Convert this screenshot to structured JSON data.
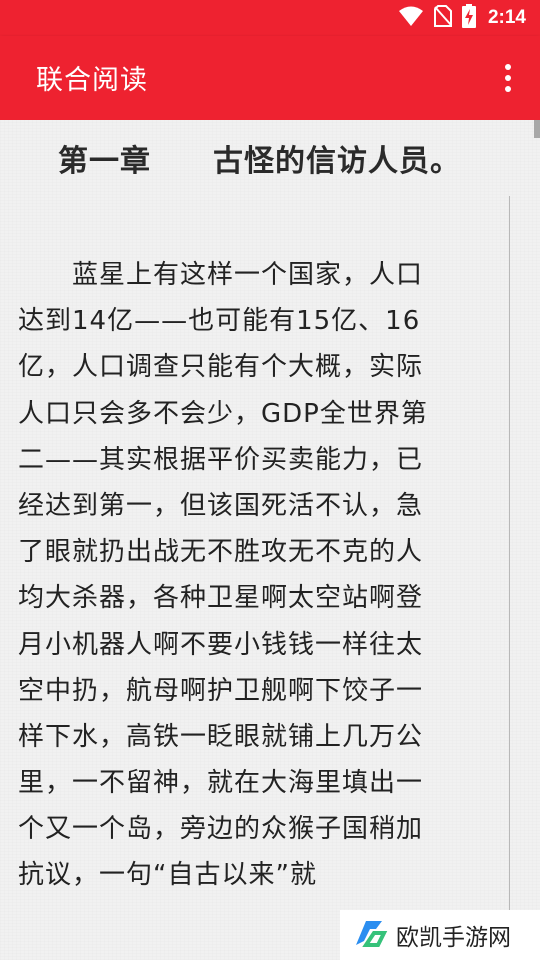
{
  "status_bar": {
    "time": "2:14",
    "icons": [
      "wifi-icon",
      "no-sim-icon",
      "battery-charging-icon"
    ]
  },
  "app_bar": {
    "title": "联合阅读",
    "menu_icon": "overflow-menu-icon",
    "color": "#ee2230"
  },
  "reader": {
    "chapter_title": "第一章　　古怪的信访人员。",
    "lines": [
      "　　蓝星上有这样一个国家，人口",
      "达到14亿——也可能有15亿、16",
      "亿，人口调查只能有个大概，实际",
      "人口只会多不会少，GDP全世界第",
      "二——其实根据平价买卖能力，已",
      "经达到第一，但该国死活不认，急",
      "了眼就扔出战无不胜攻无不克的人",
      "均大杀器，各种卫星啊太空站啊登",
      "月小机器人啊不要小钱钱一样往太",
      "空中扔，航母啊护卫舰啊下饺子一",
      "样下水，高铁一眨眼就铺上几万公",
      "里，一不留神，就在大海里填出一",
      "个又一个岛，旁边的众猴子国稍加",
      "抗议，一句“自古以来”就"
    ]
  },
  "watermark": {
    "text": "欧凯手游网",
    "logo_icon": "ok-logo-icon",
    "colors": [
      "#2b8ef0",
      "#36c27a"
    ]
  }
}
